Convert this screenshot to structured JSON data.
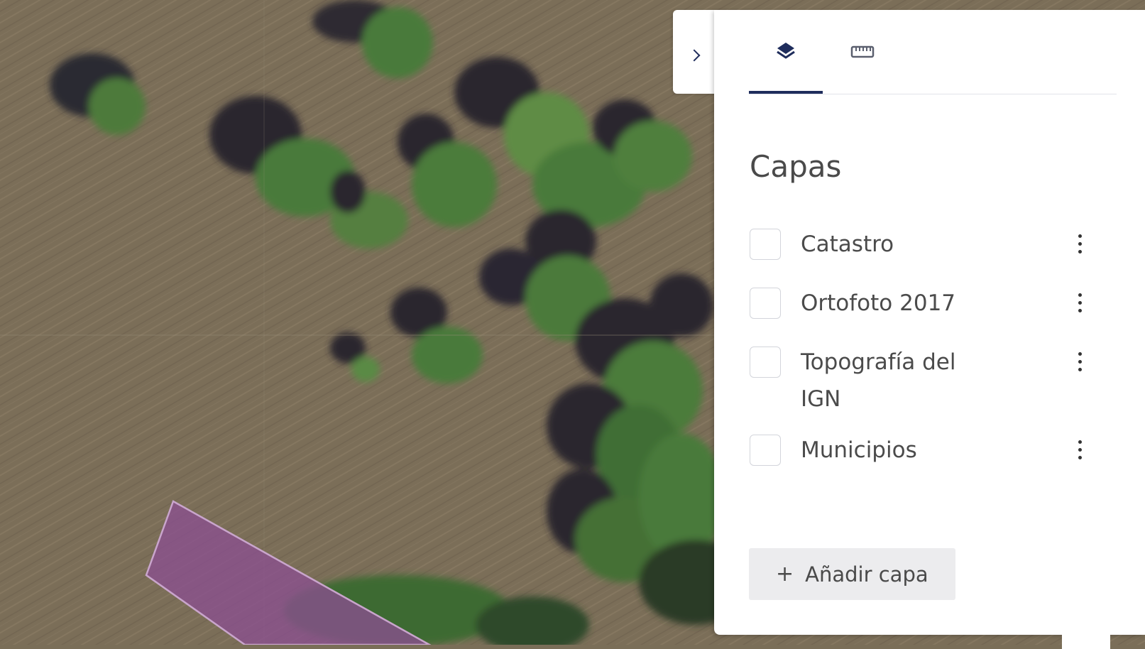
{
  "panel": {
    "tabs": [
      {
        "name": "layers",
        "icon": "layers-icon",
        "active": true
      },
      {
        "name": "measure",
        "icon": "ruler-icon",
        "active": false
      }
    ],
    "title": "Capas",
    "layers": [
      {
        "label": "Catastro",
        "checked": false
      },
      {
        "label": "Ortofoto 2017",
        "checked": false
      },
      {
        "label": "Topografía del IGN",
        "checked": false
      },
      {
        "label": "Municipios",
        "checked": false
      }
    ],
    "add_button": {
      "icon": "plus-icon",
      "label": "Añadir capa"
    }
  },
  "colors": {
    "accent": "#1f2d5c",
    "parcel_fill": "#8b4f8f",
    "panel_bg": "#ffffff"
  }
}
